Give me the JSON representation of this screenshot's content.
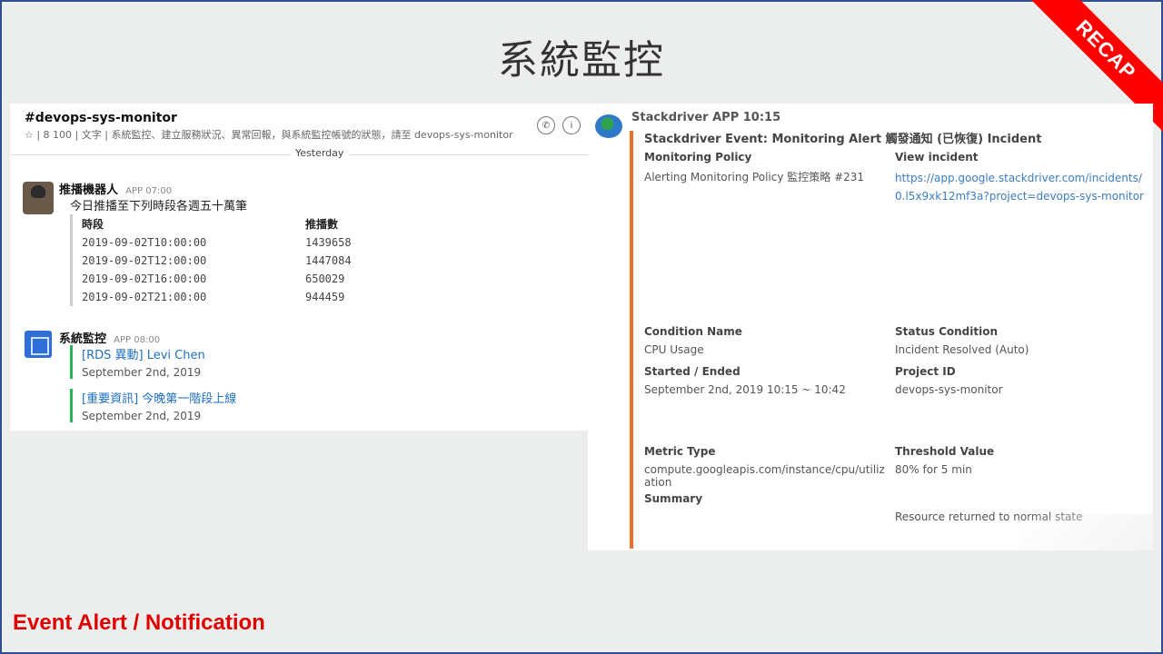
{
  "slide": {
    "title": "系統監控",
    "ribbon": "RECAP",
    "footer": "Event Alert / Notification"
  },
  "chat": {
    "channel": "#devops-sys-monitor",
    "meta": "☆ | 8 100 | 文字 | 系統監控、建立服務狀況、異常回報，與系統監控帳號的狀態，請至 devops-sys-monitor",
    "day_divider": "Yesterday",
    "message1": {
      "sender": "推播機器人",
      "time": "APP 07:00",
      "body": "今日推播至下列時段各週五十萬筆",
      "columns": [
        "時段",
        "推播數"
      ],
      "rows": [
        [
          "2019-09-02T10:00:00",
          "1439658"
        ],
        [
          "2019-09-02T12:00:00",
          "1447084"
        ],
        [
          "2019-09-02T16:00:00",
          "650029"
        ],
        [
          "2019-09-02T21:00:00",
          "944459"
        ]
      ]
    },
    "message2": {
      "sender": "系統監控",
      "time": "APP 08:00",
      "notices": [
        {
          "title": "[RDS 異動] Levi Chen",
          "date": "September 2nd, 2019"
        },
        {
          "title": "[重要資訊] 今晚第一階段上線",
          "date": "September 2nd, 2019"
        }
      ]
    }
  },
  "detail": {
    "bot": "Stackdriver APP 10:15",
    "title": "Stackdriver Event: Monitoring Alert 觸發通知 (已恢復) Incident",
    "fields": {
      "policy_key": "Monitoring Policy",
      "policy_val": "Alerting Monitoring Policy 監控策略 #231",
      "link_key": "View incident",
      "link_val": "https://app.google.stackdriver.com/incidents/0.l5x9xk12mf3a?project=devops-sys-monitor",
      "resource_key": "Condition Name",
      "resource_val": "CPU Usage",
      "status_key": "Status Condition",
      "status_val": "Incident Resolved (Auto)",
      "url_key": "Started / Ended",
      "url_val": "September 2nd, 2019 10:15 ~ 10:42",
      "project_key": "Project ID",
      "project_val": "devops-sys-monitor",
      "metric_key": "Metric Type",
      "metric_val": "compute.googleapis.com/instance/cpu/utilization",
      "threshold_key": "Threshold Value",
      "threshold_val": "80% for 5 min",
      "summary_key": "Summary",
      "summary_val": "Resource returned to normal state"
    }
  }
}
